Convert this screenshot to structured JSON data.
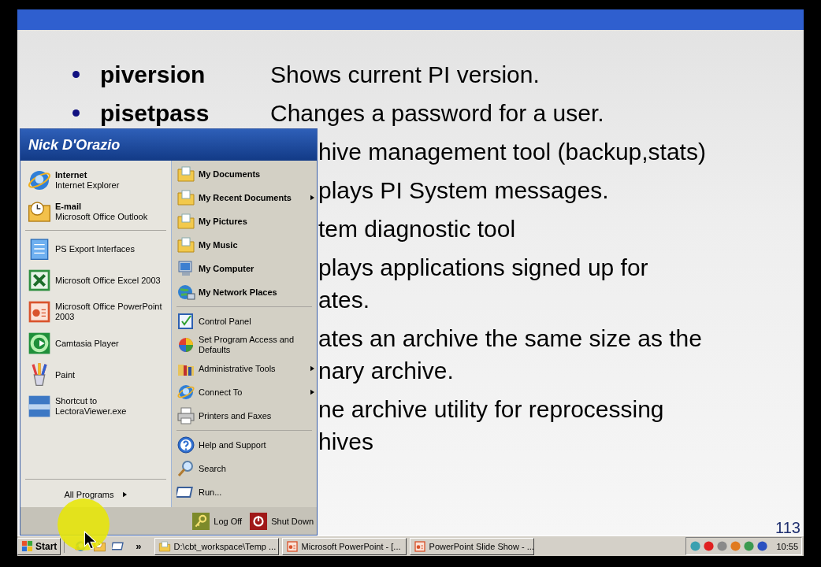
{
  "slide": {
    "rows": [
      {
        "kind": "entry",
        "command": "piversion",
        "description": "Shows current PI version."
      },
      {
        "kind": "entry",
        "command": "pisetpass",
        "description": "Changes a password for a user."
      },
      {
        "kind": "fragment",
        "text": "hive management tool (backup,stats)"
      },
      {
        "kind": "fragment",
        "text": "plays PI System messages."
      },
      {
        "kind": "fragment",
        "text": "tem diagnostic tool"
      },
      {
        "kind": "fragment",
        "text": "plays applications signed up for"
      },
      {
        "kind": "wrap",
        "text": "ates."
      },
      {
        "kind": "fragment",
        "text": "ates an archive the same size as the"
      },
      {
        "kind": "wrap",
        "text": "nary archive."
      },
      {
        "kind": "fragment",
        "text": "ne archive utility for reprocessing"
      },
      {
        "kind": "wrap",
        "text": "hives"
      }
    ],
    "page_number": "113"
  },
  "start_menu": {
    "user": "Nick D'Orazio",
    "pinned": [
      {
        "title": "Internet",
        "subtitle": "Internet Explorer"
      },
      {
        "title": "E-mail",
        "subtitle": "Microsoft Office Outlook"
      }
    ],
    "recent": [
      "PS Export Interfaces",
      "Microsoft Office Excel 2003",
      "Microsoft Office PowerPoint 2003",
      "Camtasia Player",
      "Paint",
      "Shortcut to LectoraViewer.exe"
    ],
    "all_programs": "All Programs",
    "groups": [
      {
        "items": [
          {
            "label": "My Documents",
            "submenu": false
          },
          {
            "label": "My Recent Documents",
            "submenu": true
          },
          {
            "label": "My Pictures",
            "submenu": false
          },
          {
            "label": "My Music",
            "submenu": false
          },
          {
            "label": "My Computer",
            "submenu": false
          },
          {
            "label": "My Network Places",
            "submenu": false
          }
        ]
      },
      {
        "items": [
          {
            "label": "Control Panel",
            "submenu": false
          },
          {
            "label": "Set Program Access and Defaults",
            "submenu": false
          },
          {
            "label": "Administrative Tools",
            "submenu": true
          },
          {
            "label": "Connect To",
            "submenu": true
          },
          {
            "label": "Printers and Faxes",
            "submenu": false
          }
        ]
      },
      {
        "items": [
          {
            "label": "Help and Support",
            "submenu": false
          },
          {
            "label": "Search",
            "submenu": false
          },
          {
            "label": "Run...",
            "submenu": false
          }
        ]
      }
    ],
    "log_off": "Log Off",
    "shut_down": "Shut Down"
  },
  "taskbar": {
    "start": "Start",
    "overflow": "»",
    "tasks": [
      "D:\\cbt_workspace\\Temp ...",
      "Microsoft PowerPoint - [...",
      "PowerPoint Slide Show - ..."
    ],
    "clock": "10:55"
  }
}
